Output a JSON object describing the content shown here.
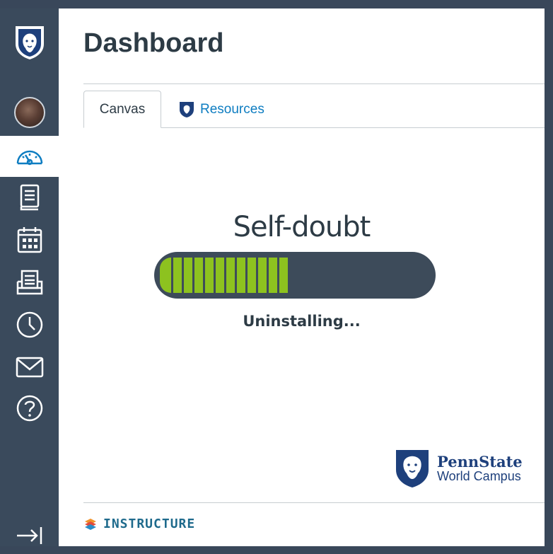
{
  "page": {
    "title": "Dashboard"
  },
  "sidebar": {
    "items": [
      {
        "icon": "penn-state-shield-logo"
      },
      {
        "icon": "avatar"
      },
      {
        "icon": "dashboard-icon",
        "active": true
      },
      {
        "icon": "courses-icon"
      },
      {
        "icon": "calendar-icon"
      },
      {
        "icon": "inbox-icon"
      },
      {
        "icon": "history-icon"
      },
      {
        "icon": "mail-icon"
      },
      {
        "icon": "help-icon"
      },
      {
        "icon": "collapse-icon"
      }
    ]
  },
  "tabs": [
    {
      "label": "Canvas",
      "active": true
    },
    {
      "label": "Resources",
      "icon": "penn-state-shield-icon"
    }
  ],
  "progress": {
    "title": "Self-doubt",
    "status": "Uninstalling...",
    "fraction": 0.49
  },
  "branding": {
    "name": "PennState",
    "subtitle": "World Campus",
    "footer": "INSTRUCTURE"
  },
  "colors": {
    "sidebar": "#3a4a5c",
    "accent": "#0e7dc1",
    "progress_fill": "#8dc21f",
    "progress_track": "#3d4b5a"
  }
}
